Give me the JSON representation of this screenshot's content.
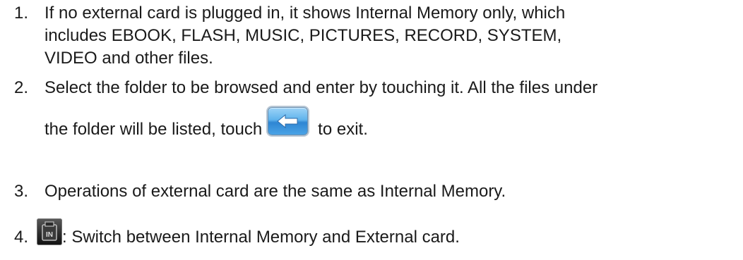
{
  "list": {
    "items": [
      {
        "number": "1.",
        "lines": [
          "If no external card is plugged in, it shows Internal Memory only, which",
          "includes EBOOK, FLASH, MUSIC, PICTURES, RECORD, SYSTEM,",
          "VIDEO and other files."
        ]
      },
      {
        "number": "2.",
        "line1": "Select the folder to be browsed and enter by touching it. All the files under",
        "line2_before": "the folder will be listed, touch",
        "line2_after": "to exit.",
        "icon": "back-arrow-button-icon"
      },
      {
        "number": "3.",
        "text": "Operations of external card are the same as Internal Memory."
      },
      {
        "number": "4.",
        "text": ": Switch between Internal Memory and External card.",
        "icon": "sd-card-switch-icon"
      }
    ]
  },
  "colors": {
    "text": "#1a1a1a",
    "button_blue": "#4aa3e6"
  }
}
